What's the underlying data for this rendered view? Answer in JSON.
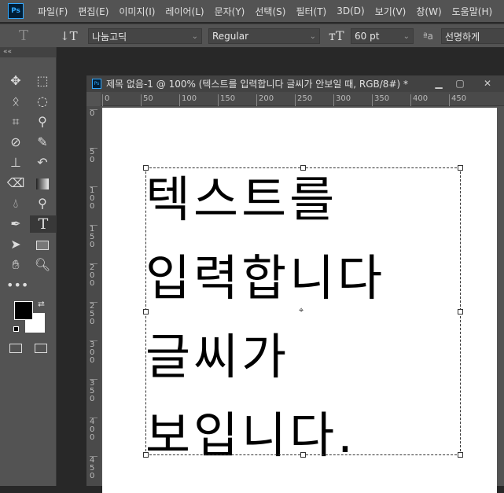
{
  "app": {
    "logo": "Ps"
  },
  "menu": [
    "파일(F)",
    "편집(E)",
    "이미지(I)",
    "레이어(L)",
    "문자(Y)",
    "선택(S)",
    "필터(T)",
    "3D(D)",
    "보기(V)",
    "창(W)",
    "도움말(H)"
  ],
  "options": {
    "font_family": "나눔고딕",
    "font_style": "Regular",
    "font_size": "60 pt",
    "antialias": "선명하게"
  },
  "tools_panel": {
    "collapse": "««"
  },
  "document": {
    "title": "제목 없음-1 @ 100% (텍스트를 입력합니다 글씨가 안보일 때, RGB/8#) *",
    "h_ruler": [
      "0",
      "50",
      "100",
      "150",
      "200",
      "250",
      "300",
      "350",
      "400",
      "450"
    ],
    "v_ruler": [
      "0",
      "50",
      "100",
      "150",
      "200",
      "250",
      "300",
      "350",
      "400",
      "450"
    ],
    "text_lines": [
      "텍스트를",
      "입력합니다",
      "글씨가",
      "보입니다."
    ]
  },
  "colors": {
    "foreground": "#000000",
    "background": "#ffffff",
    "accent": "#31a8ff"
  }
}
